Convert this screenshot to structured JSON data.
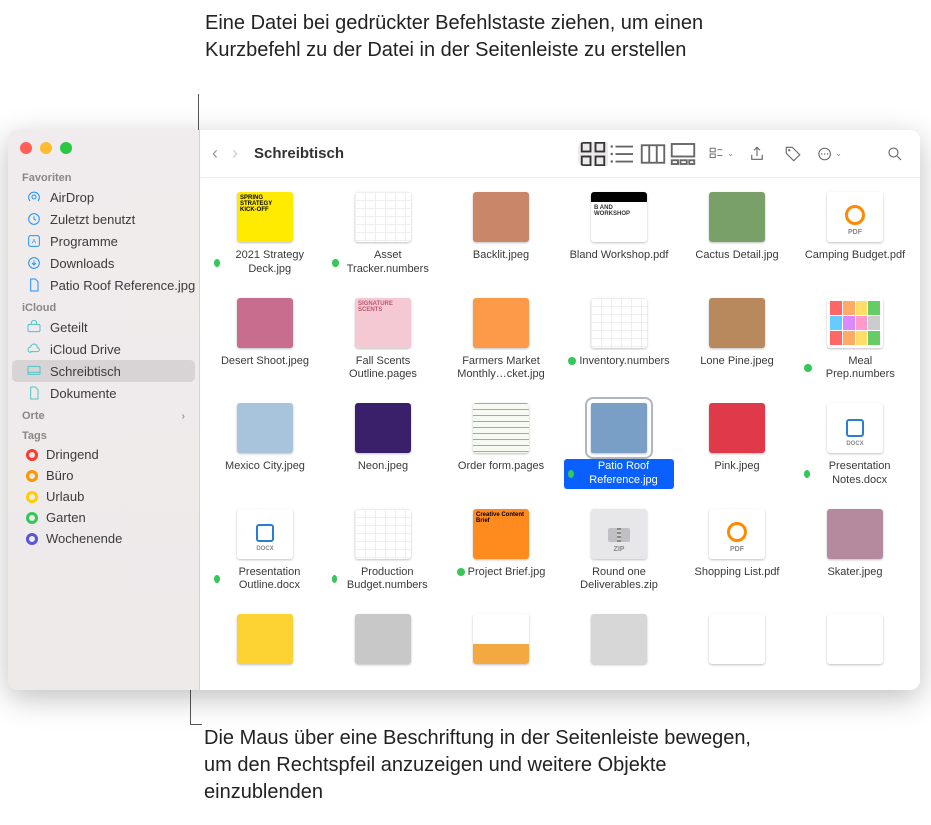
{
  "callouts": {
    "top": "Eine Datei bei gedrückter Befehlstaste ziehen, um einen Kurzbefehl zu der Datei in der Seitenleiste zu erstellen",
    "bottom": "Die Maus über eine Beschriftung in der Seitenleiste bewegen, um den Rechtspfeil anzuzeigen und weitere Objekte einzublenden"
  },
  "toolbar": {
    "title": "Schreibtisch"
  },
  "sidebar": {
    "sections": {
      "favorites_label": "Favoriten",
      "icloud_label": "iCloud",
      "locations_label": "Orte",
      "tags_label": "Tags"
    },
    "favorites": [
      {
        "label": "AirDrop",
        "icon": "airdrop"
      },
      {
        "label": "Zuletzt benutzt",
        "icon": "clock"
      },
      {
        "label": "Programme",
        "icon": "apps"
      },
      {
        "label": "Downloads",
        "icon": "download"
      },
      {
        "label": "Patio Roof Reference.jpg",
        "icon": "file"
      }
    ],
    "icloud": [
      {
        "label": "Geteilt",
        "icon": "shared"
      },
      {
        "label": "iCloud Drive",
        "icon": "cloud"
      },
      {
        "label": "Schreibtisch",
        "icon": "desktop",
        "selected": true
      },
      {
        "label": "Dokumente",
        "icon": "doc"
      }
    ],
    "tags": [
      {
        "label": "Dringend",
        "color": "#ff3b30"
      },
      {
        "label": "Büro",
        "color": "#ff9500"
      },
      {
        "label": "Urlaub",
        "color": "#ffcc00"
      },
      {
        "label": "Garten",
        "color": "#34c759"
      },
      {
        "label": "Wochenende",
        "color": "#5856d6"
      }
    ]
  },
  "files": [
    {
      "label": "2021 Strategy Deck.jpg",
      "tag": "#34c759",
      "thumb": {
        "bg": "#ffeb00",
        "text": "SPRING STRATEGY KICK-OFF",
        "fg": "#000"
      }
    },
    {
      "label": "Asset Tracker.numbers",
      "tag": "#34c759",
      "thumb": {
        "bg": "#fff",
        "grid": true
      }
    },
    {
      "label": "Backlit.jpeg",
      "thumb": {
        "bg": "#ca8668"
      }
    },
    {
      "label": "Bland Workshop.pdf",
      "thumb": {
        "bg": "#fff",
        "text": "B AND WORKSHOP",
        "bar": "#000"
      }
    },
    {
      "label": "Cactus Detail.jpg",
      "thumb": {
        "bg": "#7aa06a"
      }
    },
    {
      "label": "Camping Budget.pdf",
      "thumb": {
        "bg": "#fff",
        "icon": "pdf"
      }
    },
    {
      "label": "Desert Shoot.jpeg",
      "thumb": {
        "bg": "#c96d8f"
      }
    },
    {
      "label": "Fall Scents Outline.pages",
      "thumb": {
        "bg": "#f4c9d4",
        "text": "SIGNATURE SCENTS",
        "fg": "#c0566f"
      }
    },
    {
      "label": "Farmers Market Monthly…cket.jpg",
      "thumb": {
        "bg": "#fc9a4a"
      }
    },
    {
      "label": "Inventory.numbers",
      "tag": "#34c759",
      "thumb": {
        "bg": "#fff",
        "grid": true
      }
    },
    {
      "label": "Lone Pine.jpeg",
      "thumb": {
        "bg": "#b8895d"
      }
    },
    {
      "label": "Meal Prep.numbers",
      "tag": "#34c759",
      "thumb": {
        "bg": "#fff",
        "cal": true
      }
    },
    {
      "label": "Mexico City.jpeg",
      "thumb": {
        "bg": "#a8c4dc"
      }
    },
    {
      "label": "Neon.jpeg",
      "thumb": {
        "bg": "#3a1f6b"
      }
    },
    {
      "label": "Order form.pages",
      "thumb": {
        "bg": "#f6faf3",
        "lines": true
      }
    },
    {
      "label": "Patio Roof Reference.jpg",
      "tag": "#34c759",
      "selected": true,
      "thumb": {
        "bg": "#7a9fc7"
      }
    },
    {
      "label": "Pink.jpeg",
      "thumb": {
        "bg": "#e0394a"
      }
    },
    {
      "label": "Presentation Notes.docx",
      "tag": "#34c759",
      "thumb": {
        "bg": "#fff",
        "icon": "docx"
      }
    },
    {
      "label": "Presentation Outline.docx",
      "tag": "#34c759",
      "thumb": {
        "bg": "#fff",
        "icon": "docx"
      }
    },
    {
      "label": "Production Budget.numbers",
      "tag": "#34c759",
      "thumb": {
        "bg": "#fff",
        "grid": true
      }
    },
    {
      "label": "Project Brief.jpg",
      "tag": "#34c759",
      "thumb": {
        "bg": "#ff8b1f",
        "text": "Creative Content Brief",
        "fg": "#000"
      }
    },
    {
      "label": "Round one Deliverables.zip",
      "thumb": {
        "bg": "#e7e7e9",
        "icon": "zip"
      }
    },
    {
      "label": "Shopping List.pdf",
      "thumb": {
        "bg": "#fff",
        "icon": "pdf"
      }
    },
    {
      "label": "Skater.jpeg",
      "thumb": {
        "bg": "#b58a9f"
      }
    },
    {
      "label": "",
      "thumb": {
        "bg": "#fdd333"
      }
    },
    {
      "label": "",
      "thumb": {
        "bg": "#c8c8c8"
      }
    },
    {
      "label": "",
      "thumb": {
        "bg": "#fff",
        "strip": true
      }
    },
    {
      "label": "",
      "thumb": {
        "bg": "#d7d7d7"
      }
    },
    {
      "label": "",
      "thumb": {
        "bg": "#fff"
      }
    },
    {
      "label": "",
      "thumb": {
        "bg": "#fff"
      }
    }
  ]
}
